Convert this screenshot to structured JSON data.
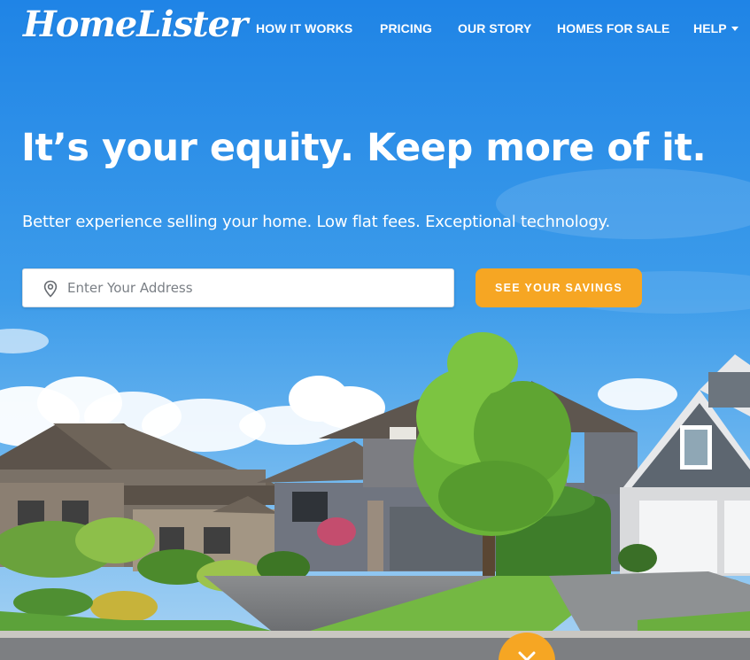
{
  "brand": {
    "logo_text": "HomeLister"
  },
  "nav": {
    "items": [
      {
        "label": "HOW IT WORKS"
      },
      {
        "label": "PRICING"
      },
      {
        "label": "OUR STORY"
      },
      {
        "label": "HOMES FOR SALE"
      },
      {
        "label": "HELP"
      }
    ]
  },
  "hero": {
    "headline": "It’s your equity. Keep more of it.",
    "subhead": "Better experience selling your home. Low flat fees. Exceptional technology."
  },
  "search": {
    "icon": "map-pin-icon",
    "placeholder": "Enter Your Address",
    "value": "",
    "button_label": "SEE YOUR SAVINGS"
  },
  "scroll": {
    "icon": "chevron-down-icon"
  },
  "colors": {
    "sky": "#2c8ee8",
    "accent": "#f6a623",
    "text_light": "#ffffff"
  }
}
